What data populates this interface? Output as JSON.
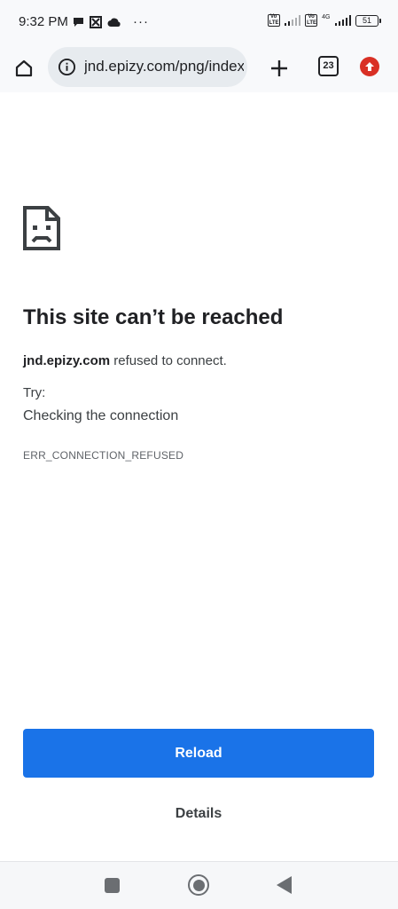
{
  "status_bar": {
    "time": "9:32 PM",
    "more_dots": "···",
    "volte_label": "Vo LTE",
    "network_label": "4G",
    "battery": "51"
  },
  "toolbar": {
    "url": "jnd.epizy.com/png/index",
    "tab_count": "23"
  },
  "error_page": {
    "title": "This site can’t be reached",
    "host": "jnd.epizy.com",
    "message": " refused to connect.",
    "try_label": "Try:",
    "suggestion": "Checking the connection",
    "error_code": "ERR_CONNECTION_REFUSED",
    "reload_label": "Reload",
    "details_label": "Details"
  },
  "colors": {
    "accent": "#1a73e8",
    "update_badge": "#d93025",
    "toolbar_bg": "#f8f9fb"
  },
  "icons": [
    "home-icon",
    "info-icon",
    "plus-icon",
    "tab-switcher-icon",
    "update-arrow-icon",
    "sad-document-icon",
    "recents-icon",
    "home-circle-icon",
    "back-icon"
  ]
}
